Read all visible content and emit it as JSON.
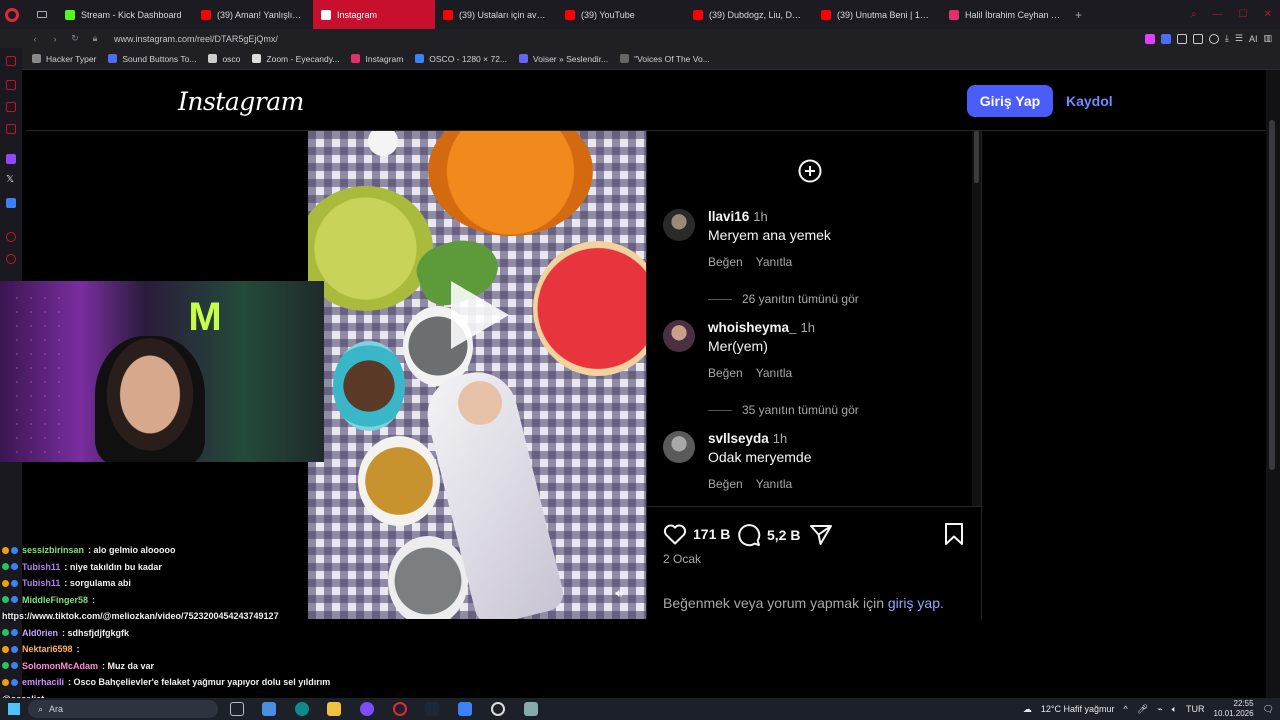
{
  "browser": {
    "tabs": [
      {
        "label": "Stream - Kick Dashboard",
        "color": "#53fc18",
        "active": false
      },
      {
        "label": "(39) Aman! Yanlışlıkla Söy",
        "color": "#ff0000",
        "active": false
      },
      {
        "label": "Instagram",
        "color": "#e1306c",
        "active": true
      },
      {
        "label": "(39) Ustaları için avakadol",
        "color": "#ff0000",
        "active": false
      },
      {
        "label": "(39) YouTube",
        "color": "#ff0000",
        "active": false
      },
      {
        "label": "(39) Dubdogz, Liu, Dubdi",
        "color": "#ff0000",
        "active": false
      },
      {
        "label": "(39) Unutma Beni | 1. Bölü",
        "color": "#ff0000",
        "active": false
      },
      {
        "label": "Halil İbrahim Ceyhan (@ha",
        "color": "#e1306c",
        "active": false
      }
    ],
    "new_tab": "+",
    "url": "www.instagram.com/reel/DTAR5gEjQmx/",
    "bookmarks": [
      {
        "label": "Hacker Typer",
        "color": "#888888"
      },
      {
        "label": "Sound Buttons To...",
        "color": "#4c6ef5"
      },
      {
        "label": "osco",
        "color": "#cccccc"
      },
      {
        "label": "Zoom - Eyecandy...",
        "color": "#dddddd"
      },
      {
        "label": "Instagram",
        "color": "#e1306c"
      },
      {
        "label": "OSCO - 1280 × 72...",
        "color": "#3b82f6"
      },
      {
        "label": "Voiser » Seslendir...",
        "color": "#6366f1"
      },
      {
        "label": "\"Voices Of The Vo...",
        "color": "#666666"
      }
    ],
    "ai_label": "AI"
  },
  "instagram": {
    "logo": "Instagram",
    "login_button": "Giriş Yap",
    "signup_link": "Kaydol",
    "comments": [
      {
        "user": "llavi16",
        "time": "1h",
        "text": "Meryem ana yemek",
        "like": "Beğen",
        "reply": "Yanıtla",
        "replies": "26 yanıtın tümünü gör"
      },
      {
        "user": "whoisheyma_",
        "time": "1h",
        "text": "Mer(yem)",
        "like": "Beğen",
        "reply": "Yanıtla",
        "replies": "35 yanıtın tümünü gör"
      },
      {
        "user": "svllseyda",
        "time": "1h",
        "text": "Odak meryemde",
        "like": "Beğen",
        "reply": "Yanıtla"
      }
    ],
    "likes": "171 B",
    "comment_count": "5,2 B",
    "date": "2 Ocak",
    "login_prompt": "Beğenmek veya yorum yapmak için ",
    "login_prompt_link": "giriş yap",
    "login_prompt_end": "."
  },
  "chat": [
    {
      "user": "sessizbirinsan",
      "color": "#7ee07e",
      "msg": ": alo gelmio alooooo"
    },
    {
      "user": "Tubish11",
      "color": "#b07de8",
      "msg": ": niye takıldın bu kadar"
    },
    {
      "user": "Tubish11",
      "color": "#b07de8",
      "msg": ": sorgulama abi"
    },
    {
      "user": "MiddleFinger58",
      "color": "#7ee07e",
      "msg": ":"
    },
    {
      "user": "",
      "color": "#ffffff",
      "msg": "https://www.tiktok.com/@meliozkan/video/7523200454243749127"
    },
    {
      "user": "Ald0rien",
      "color": "#c8a2ff",
      "msg": ": sdhsfjdjfgkgfk"
    },
    {
      "user": "Nektari6598",
      "color": "#ffb060",
      "msg": ":"
    },
    {
      "user": "SolomonMcAdam",
      "color": "#ff8ad8",
      "msg": ": Muz da var"
    },
    {
      "user": "emirhacili",
      "color": "#d28cff",
      "msg": ": Osco Bahçelievler'e felaket yağmur yapıyor dolu sel yıldırım"
    },
    {
      "user": "",
      "color": "#ffffff",
      "msg": "@osceliat"
    }
  ],
  "taskbar": {
    "search_placeholder": "Ara",
    "weather": "12°C  Hafif yağmur",
    "language": "TUR",
    "time": "22:55",
    "date": "10.01.2026"
  }
}
